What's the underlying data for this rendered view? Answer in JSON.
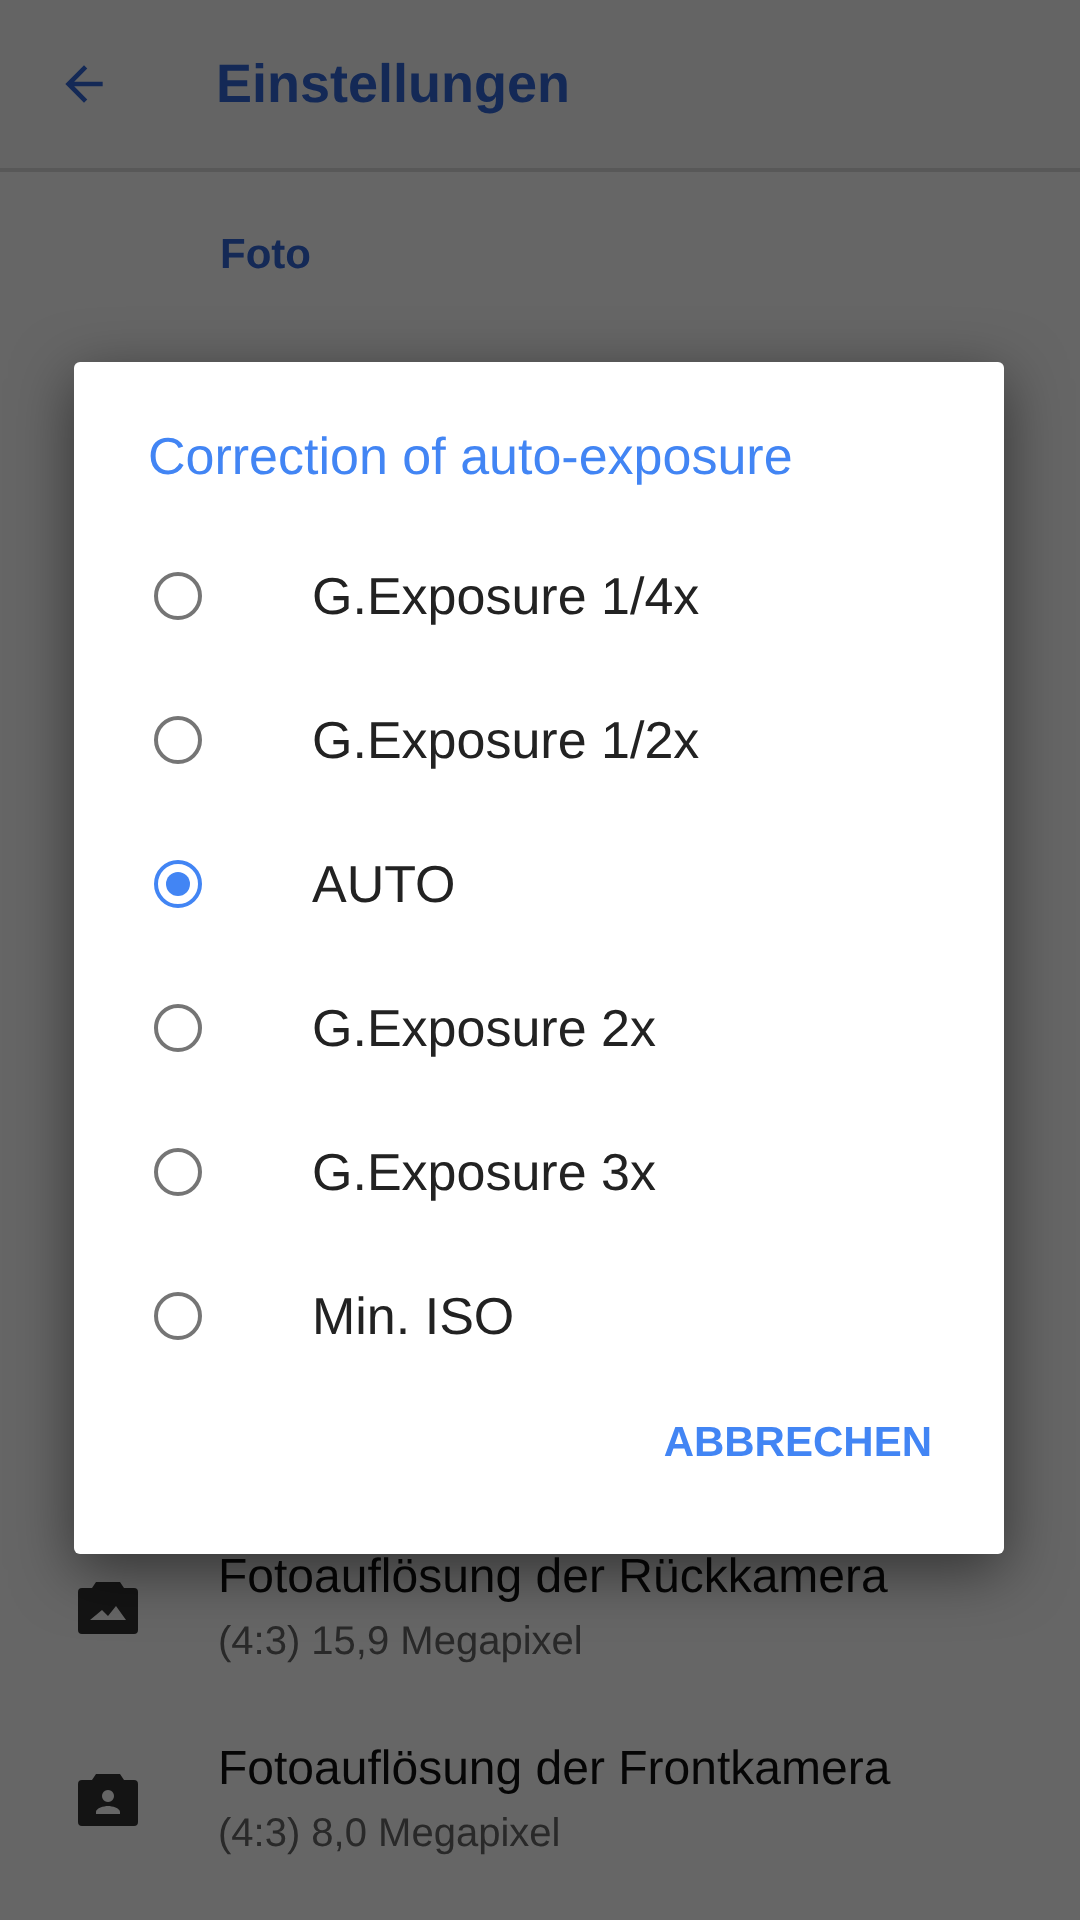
{
  "app_bar": {
    "title": "Einstellungen"
  },
  "section": {
    "title": "Foto"
  },
  "settings": [
    {
      "kind": "rear",
      "title": "Fotoauflösung der Rückkamera",
      "subtitle": "(4:3) 15,9 Megapixel"
    },
    {
      "kind": "front",
      "title": "Fotoauflösung der Frontkamera",
      "subtitle": "(4:3) 8,0 Megapixel"
    }
  ],
  "dialog": {
    "title": "Correction of auto-exposure",
    "options": [
      {
        "label": "G.Exposure 1/4x",
        "selected": false
      },
      {
        "label": "G.Exposure 1/2x",
        "selected": false
      },
      {
        "label": "AUTO",
        "selected": true
      },
      {
        "label": "G.Exposure 2x",
        "selected": false
      },
      {
        "label": "G.Exposure 3x",
        "selected": false
      },
      {
        "label": "Min. ISO",
        "selected": false
      }
    ],
    "button": "ABBRECHEN"
  }
}
